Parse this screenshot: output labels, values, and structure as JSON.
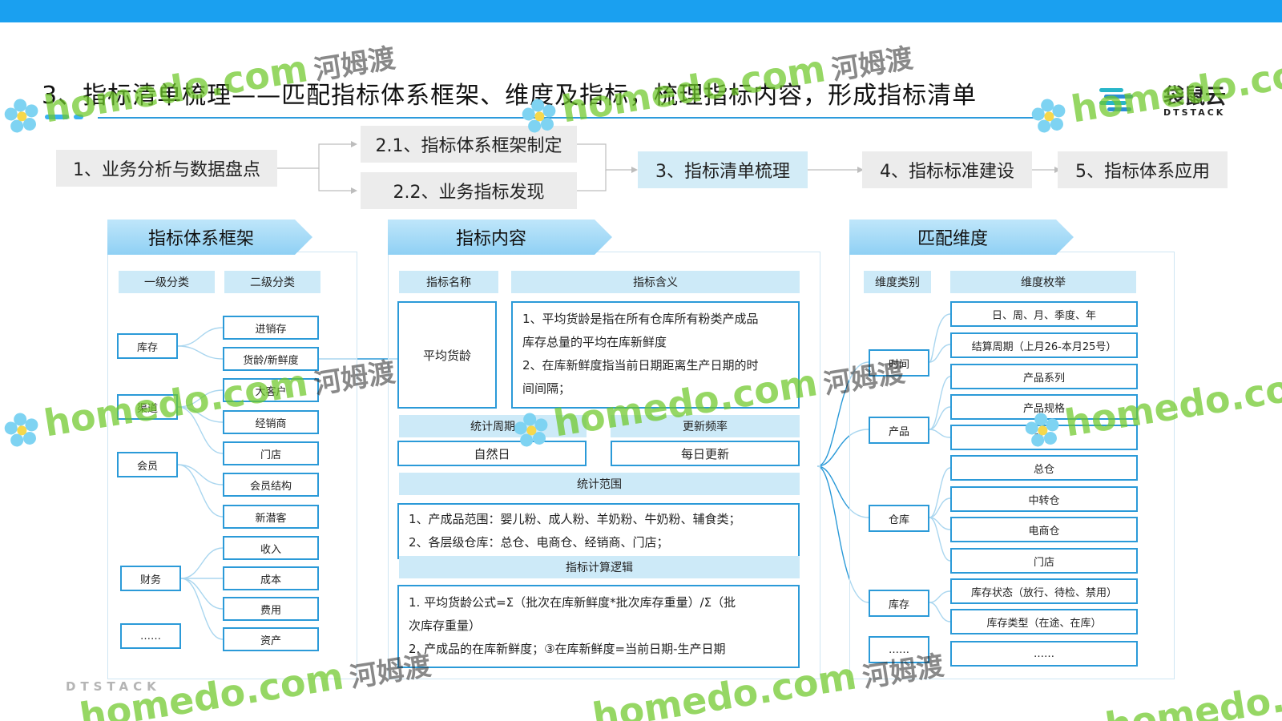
{
  "title": "3、指标清单梳理——匹配指标体系框架、维度及指标，梳理指标内容，形成指标清单",
  "logo": {
    "name": "袋鼠云",
    "sub": "DTSTACK"
  },
  "footer_brand": "DTSTACK",
  "steps": [
    "1、业务分析与数据盘点",
    "2.1、指标体系框架制定",
    "2.2、业务指标发现",
    "3、指标清单梳理",
    "4、指标标准建设",
    "5、指标体系应用"
  ],
  "framework": {
    "banner": "指标体系框架",
    "col1": "一级分类",
    "col2": "二级分类",
    "level1": [
      "库存",
      "渠道",
      "会员",
      "财务",
      "……"
    ],
    "level2": [
      "进销存",
      "货龄/新鲜度",
      "大客户",
      "经销商",
      "门店",
      "会员结构",
      "新潜客",
      "收入",
      "成本",
      "费用",
      "资产"
    ]
  },
  "content": {
    "banner": "指标内容",
    "name_header": "指标名称",
    "meaning_header": "指标含义",
    "name": "平均货龄",
    "meaning": [
      "1、平均货龄是指在所有仓库所有粉类产成品",
      "库存总量的平均在库新鲜度",
      "2、在库新鲜度指当前日期距离生产日期的时",
      "间间隔；"
    ],
    "period_header": "统计周期",
    "freq_header": "更新频率",
    "period": "自然日",
    "freq": "每日更新",
    "scope_header": "统计范围",
    "scope": [
      "1、产成品范围：婴儿粉、成人粉、羊奶粉、牛奶粉、辅食类；",
      "2、各层级仓库：总仓、电商仓、经销商、门店；"
    ],
    "logic_header": "指标计算逻辑",
    "logic": [
      "1.   平均货龄公式=Σ（批次在库新鲜度*批次库存重量）/Σ（批",
      "      次库存重量）",
      "2.   产成品的在库新鲜度；③在库新鲜度=当前日期-生产日期"
    ]
  },
  "dimensions": {
    "banner": "匹配维度",
    "col1": "维度类别",
    "col2": "维度枚举",
    "categories": [
      "时间",
      "产品",
      "仓库",
      "库存",
      "……"
    ],
    "values": [
      "日、周、月、季度、年",
      "结算周期（上月26-本月25号）",
      "产品系列",
      "产品规格",
      "段位",
      "总仓",
      "中转仓",
      "电商仓",
      "门店",
      "库存状态（放行、待检、禁用）",
      "库存类型（在途、在库）",
      "……"
    ]
  },
  "watermark": {
    "latin": "homedo.com",
    "cn": "河姆渡"
  },
  "colors": {
    "topbar": "#1aa0f0",
    "accent": "#2b9ad8",
    "header_fill": "#cdeaf8",
    "watermark": "#6ec828"
  }
}
